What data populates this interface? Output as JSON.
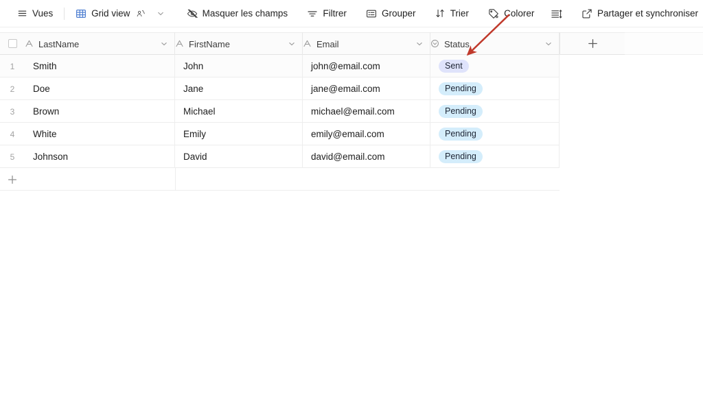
{
  "toolbar": {
    "views_label": "Vues",
    "view_name": "Grid view",
    "hide_fields_label": "Masquer les champs",
    "filter_label": "Filtrer",
    "group_label": "Grouper",
    "sort_label": "Trier",
    "color_label": "Colorer",
    "share_label": "Partager et synchroniser"
  },
  "table": {
    "columns": [
      {
        "name": "LastName",
        "type_icon": "text-field-icon"
      },
      {
        "name": "FirstName",
        "type_icon": "text-field-icon"
      },
      {
        "name": "Email",
        "type_icon": "text-field-icon"
      },
      {
        "name": "Status",
        "type_icon": "single-select-icon"
      }
    ],
    "rows": [
      {
        "num": "1",
        "LastName": "Smith",
        "FirstName": "John",
        "Email": "john@email.com",
        "Status": "Sent",
        "status_color": "#dfe3fb"
      },
      {
        "num": "2",
        "LastName": "Doe",
        "FirstName": "Jane",
        "Email": "jane@email.com",
        "Status": "Pending",
        "status_color": "#d4edfb"
      },
      {
        "num": "3",
        "LastName": "Brown",
        "FirstName": "Michael",
        "Email": "michael@email.com",
        "Status": "Pending",
        "status_color": "#d4edfb"
      },
      {
        "num": "4",
        "LastName": "White",
        "FirstName": "Emily",
        "Email": "emily@email.com",
        "Status": "Pending",
        "status_color": "#d4edfb"
      },
      {
        "num": "5",
        "LastName": "Johnson",
        "FirstName": "David",
        "Email": "david@email.com",
        "Status": "Pending",
        "status_color": "#d4edfb"
      }
    ]
  },
  "annotation": {
    "arrow_color": "#c0392b"
  }
}
